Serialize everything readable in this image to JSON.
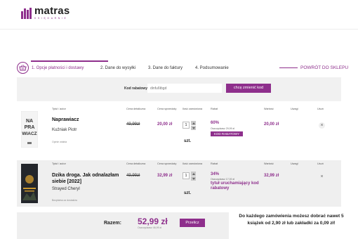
{
  "brand": {
    "name": "matras",
    "tagline": "KSIĘGARNIE",
    "color": "#8e2f8c"
  },
  "steps": [
    {
      "label": "1. Opcje płatności i dostawy",
      "active": true
    },
    {
      "label": "2. Dane do wysyłki",
      "active": false
    },
    {
      "label": "3. Dane do faktury",
      "active": false
    },
    {
      "label": "4. Podsumowanie",
      "active": false
    }
  ],
  "back_link": "POWRÓT DO SKLEPU",
  "coupon": {
    "label": "Kod rabatowy",
    "placeholder": "dinfu6tbgd",
    "button": "chcę zmienić kod"
  },
  "columns": {
    "title": "Tytuł / autor",
    "list_price": "Cena detaliczna",
    "sale_price": "Cena sprzedaży",
    "quantity": "Ilość zamówiona",
    "discount": "Rabat",
    "value": "Wartość",
    "notes": "Uwagi",
    "remove": "Usuń"
  },
  "items": [
    {
      "cover_lines": [
        "NA",
        "PRA",
        "WIACZ"
      ],
      "title": "Naprawiacz",
      "author": "Kuźniak Piotr",
      "shipping": "Opinie wtabla",
      "list_price": "49,99zł",
      "sale_price": "20,00 zł",
      "quantity": "1",
      "unit": "szt.",
      "discount_pct": "60%",
      "savings": "Oszczędzasz 29,99 zł",
      "discount_label": "KOD RABATOWY",
      "value": "20,00 zł",
      "remove_icon": "×"
    },
    {
      "title": "Dzika droga. Jak odnalazłam siebie [2022]",
      "author": "Strayed Cheryl",
      "shipping": "Bezpłatna za dostaków",
      "list_price": "49,99zł",
      "sale_price": "32,99 zł",
      "quantity": "1",
      "unit": "szt.",
      "discount_pct": "34%",
      "savings": "Oszczędzasz 17,00 zł",
      "discount_label": "tytuł uruchamiający kod rabatowy",
      "value": "32,99 zł",
      "remove_icon": "×"
    }
  ],
  "totals": {
    "label": "Razem:",
    "value": "52,99 zł",
    "savings": "Oszczędzasz 46,99 zł",
    "recalc": "Przelicz"
  },
  "promo": "Do każdego zamówienia możesz dobrać nawet 5 książek od 2,90 zł lub zakładki za 0,09 zł!"
}
